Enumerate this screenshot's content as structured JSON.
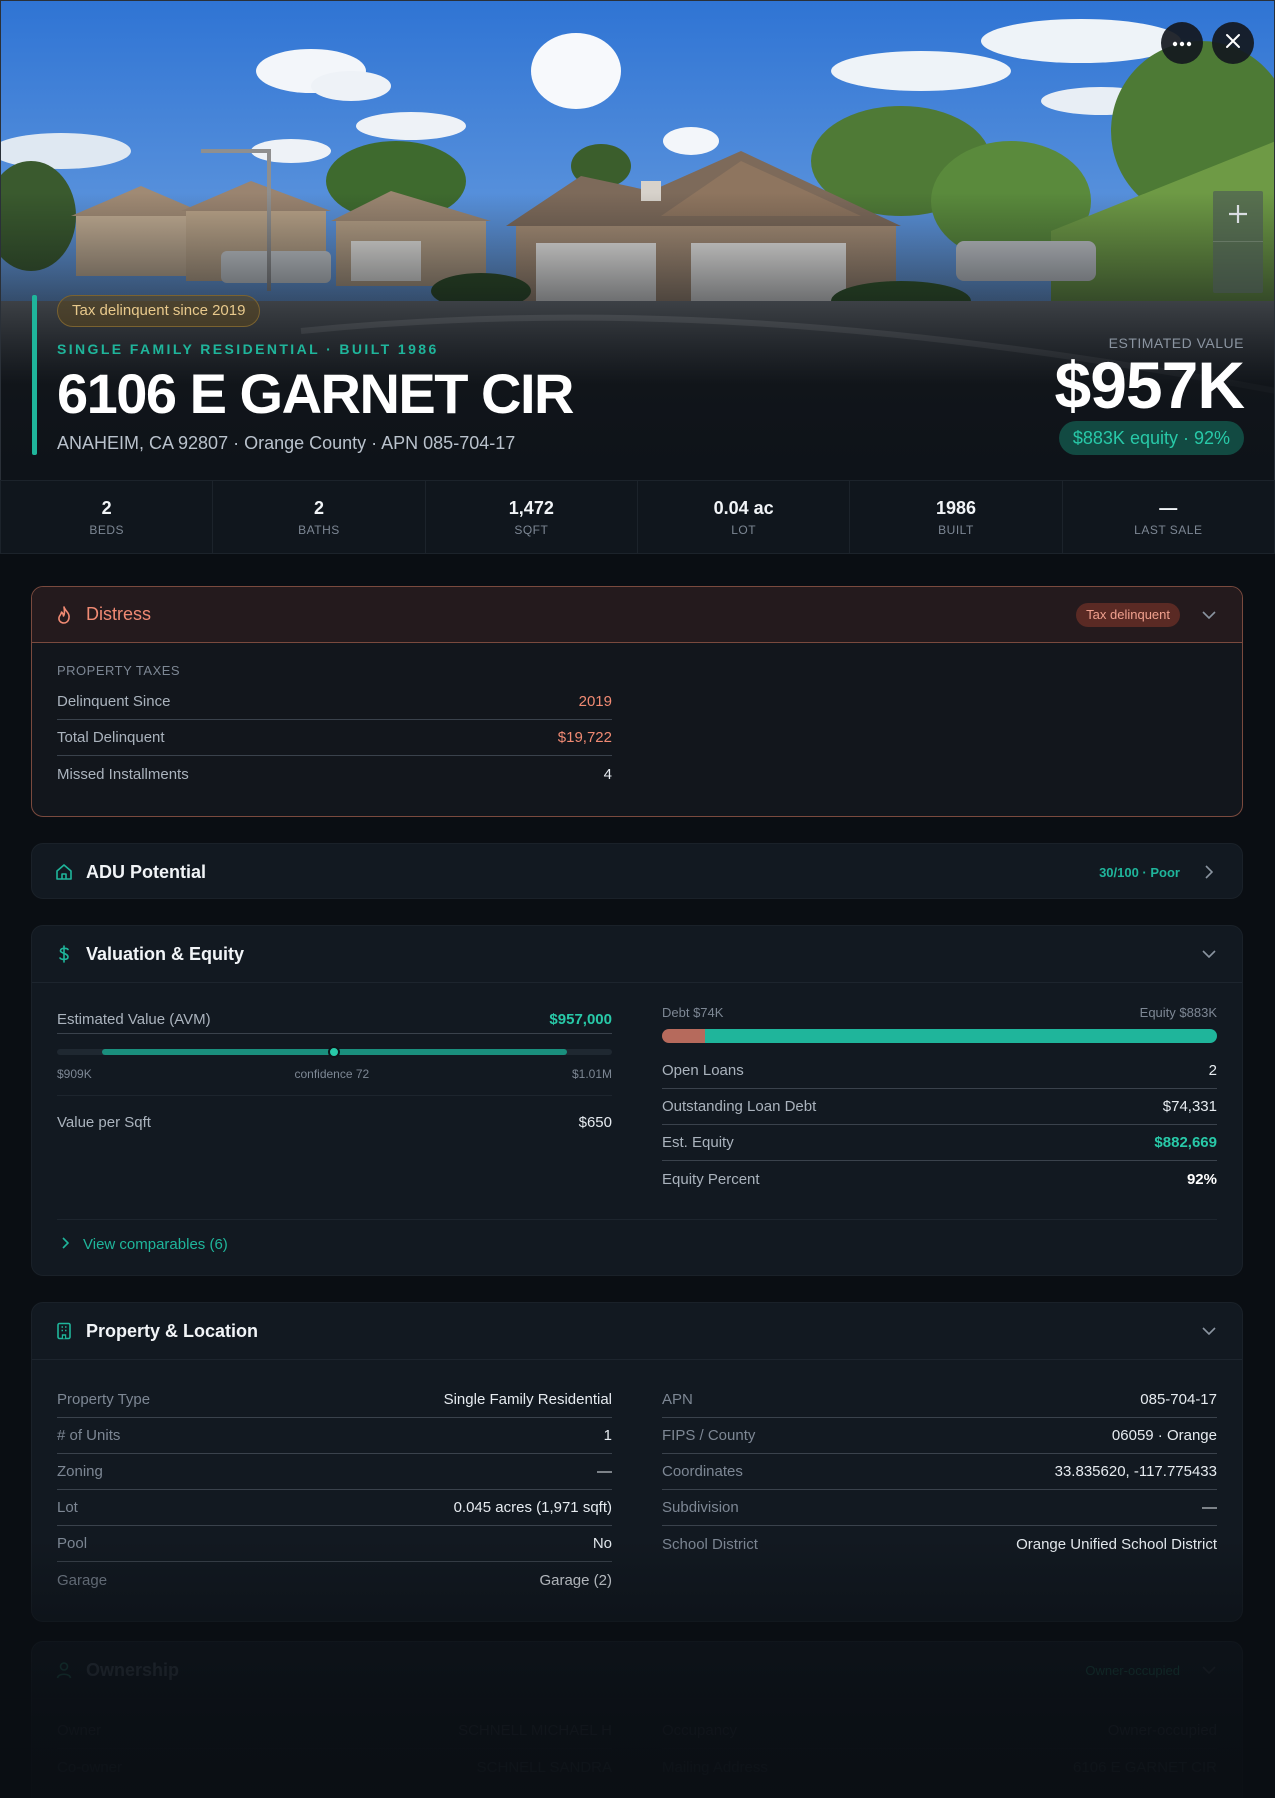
{
  "hero": {
    "tax_badge": "Tax delinquent since 2019",
    "subtype": "SINGLE FAMILY RESIDENTIAL · BUILT 1986",
    "address": "6106 E GARNET CIR",
    "location": "ANAHEIM, CA 92807 · Orange County · APN 085-704-17",
    "estimated_value_label": "ESTIMATED VALUE",
    "estimated_value": "$957K",
    "equity_badge": "$883K equity · 92%"
  },
  "stats": [
    {
      "value": "2",
      "label": "BEDS"
    },
    {
      "value": "2",
      "label": "BATHS"
    },
    {
      "value": "1,472",
      "label": "SQFT"
    },
    {
      "value": "0.04 ac",
      "label": "LOT"
    },
    {
      "value": "1986",
      "label": "BUILT"
    },
    {
      "value": "—",
      "label": "LAST SALE"
    }
  ],
  "distress": {
    "title": "Distress",
    "badge": "Tax delinquent",
    "section_label": "PROPERTY TAXES",
    "rows": [
      {
        "key": "Delinquent Since",
        "value": "2019"
      },
      {
        "key": "Total Delinquent",
        "value": "$19,722"
      },
      {
        "key": "Missed Installments",
        "value": "4"
      }
    ]
  },
  "adu": {
    "title": "ADU Potential",
    "score": "30/100 · Poor"
  },
  "valuation": {
    "title": "Valuation & Equity",
    "avm_label": "Estimated Value (AVM)",
    "avm_value": "$957,000",
    "avm_low": "$909K",
    "avm_confidence": "confidence 72",
    "avm_high": "$1.01M",
    "value_per_sqft_label": "Value per Sqft",
    "value_per_sqft": "$650",
    "debt_label": "Debt $74K",
    "equity_label": "Equity $883K",
    "debt_fraction": 0.077,
    "rows": [
      {
        "key": "Open Loans",
        "value": "2"
      },
      {
        "key": "Outstanding Loan Debt",
        "value": "$74,331"
      },
      {
        "key": "Est. Equity",
        "value": "$882,669"
      },
      {
        "key": "Equity Percent",
        "value": "92%"
      }
    ],
    "comparables_link": "View comparables (6)"
  },
  "property": {
    "title": "Property & Location",
    "left": [
      {
        "key": "Property Type",
        "value": "Single Family Residential"
      },
      {
        "key": "# of Units",
        "value": "1"
      },
      {
        "key": "Zoning",
        "value": "—"
      },
      {
        "key": "Lot",
        "value": "0.045 acres (1,971 sqft)"
      },
      {
        "key": "Pool",
        "value": "No"
      },
      {
        "key": "Garage",
        "value": "Garage (2)"
      }
    ],
    "right": [
      {
        "key": "APN",
        "value": "085-704-17"
      },
      {
        "key": "FIPS / County",
        "value": "06059 · Orange"
      },
      {
        "key": "Coordinates",
        "value": "33.835620, -117.775433"
      },
      {
        "key": "Subdivision",
        "value": "—"
      },
      {
        "key": "School District",
        "value": "Orange Unified School District"
      }
    ]
  },
  "ownership": {
    "title": "Ownership",
    "badge": "Owner-occupied",
    "left": [
      {
        "key": "Owner",
        "value": "SCHNELL MICHAEL H"
      },
      {
        "key": "Co-owner",
        "value": "SCHNELL SANDRA"
      }
    ],
    "right": [
      {
        "key": "Occupancy",
        "value": "Owner-occupied"
      },
      {
        "key": "Mailing Address",
        "value": "6106 E GARNET CIR"
      }
    ]
  },
  "colors": {
    "accent": "#1fb59b",
    "distress": "#f08a73",
    "debt": "#b66a5c",
    "tax_badge": "#e8c98c"
  },
  "icons": {
    "more": "more-horizontal-icon",
    "close": "close-icon",
    "zoom_in": "plus-icon",
    "distress": "flame-icon",
    "adu": "house-icon",
    "valuation": "dollar-icon",
    "property": "building-icon",
    "ownership": "user-icon",
    "chevron_down": "chevron-down-icon",
    "chevron_right": "chevron-right-icon"
  }
}
